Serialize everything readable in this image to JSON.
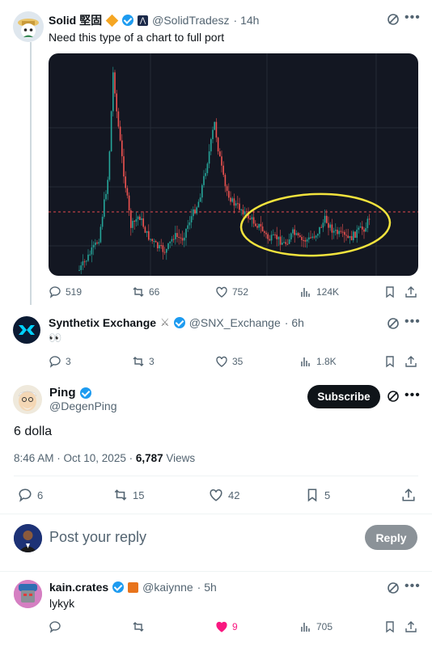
{
  "tweet1": {
    "name": "Solid 堅固",
    "handle": "@SolidTradesz",
    "time": "· 14h",
    "text": "Need this type of a chart to full port",
    "replies": "519",
    "retweets": "66",
    "likes": "752",
    "views": "124K"
  },
  "tweet2": {
    "name": "Synthetix Exchange",
    "handle": "@SNX_Exchange",
    "time": "· 6h",
    "text": "👀",
    "replies": "3",
    "retweets": "3",
    "likes": "35",
    "views": "1.8K"
  },
  "main_tweet": {
    "name": "Ping",
    "handle": "@DegenPing",
    "subscribe_label": "Subscribe",
    "text": "6 dolla",
    "timestamp": "8:46 AM · Oct 10, 2025 ·",
    "views_count": "6,787",
    "views_label": "Views",
    "replies": "6",
    "retweets": "15",
    "likes": "42",
    "bookmarks": "5"
  },
  "reply_box": {
    "placeholder": "Post your reply",
    "button": "Reply"
  },
  "tweet3": {
    "name": "kain.crates",
    "handle": "@kaiynne",
    "time": "· 5h",
    "text": "lykyk",
    "likes": "9",
    "views": "705"
  },
  "colors": {
    "accent": "#1d9bf0",
    "text_secondary": "#536471",
    "like_pink": "#f91880",
    "chart_bg": "#131722",
    "highlight_yellow": "#f2e33d"
  }
}
